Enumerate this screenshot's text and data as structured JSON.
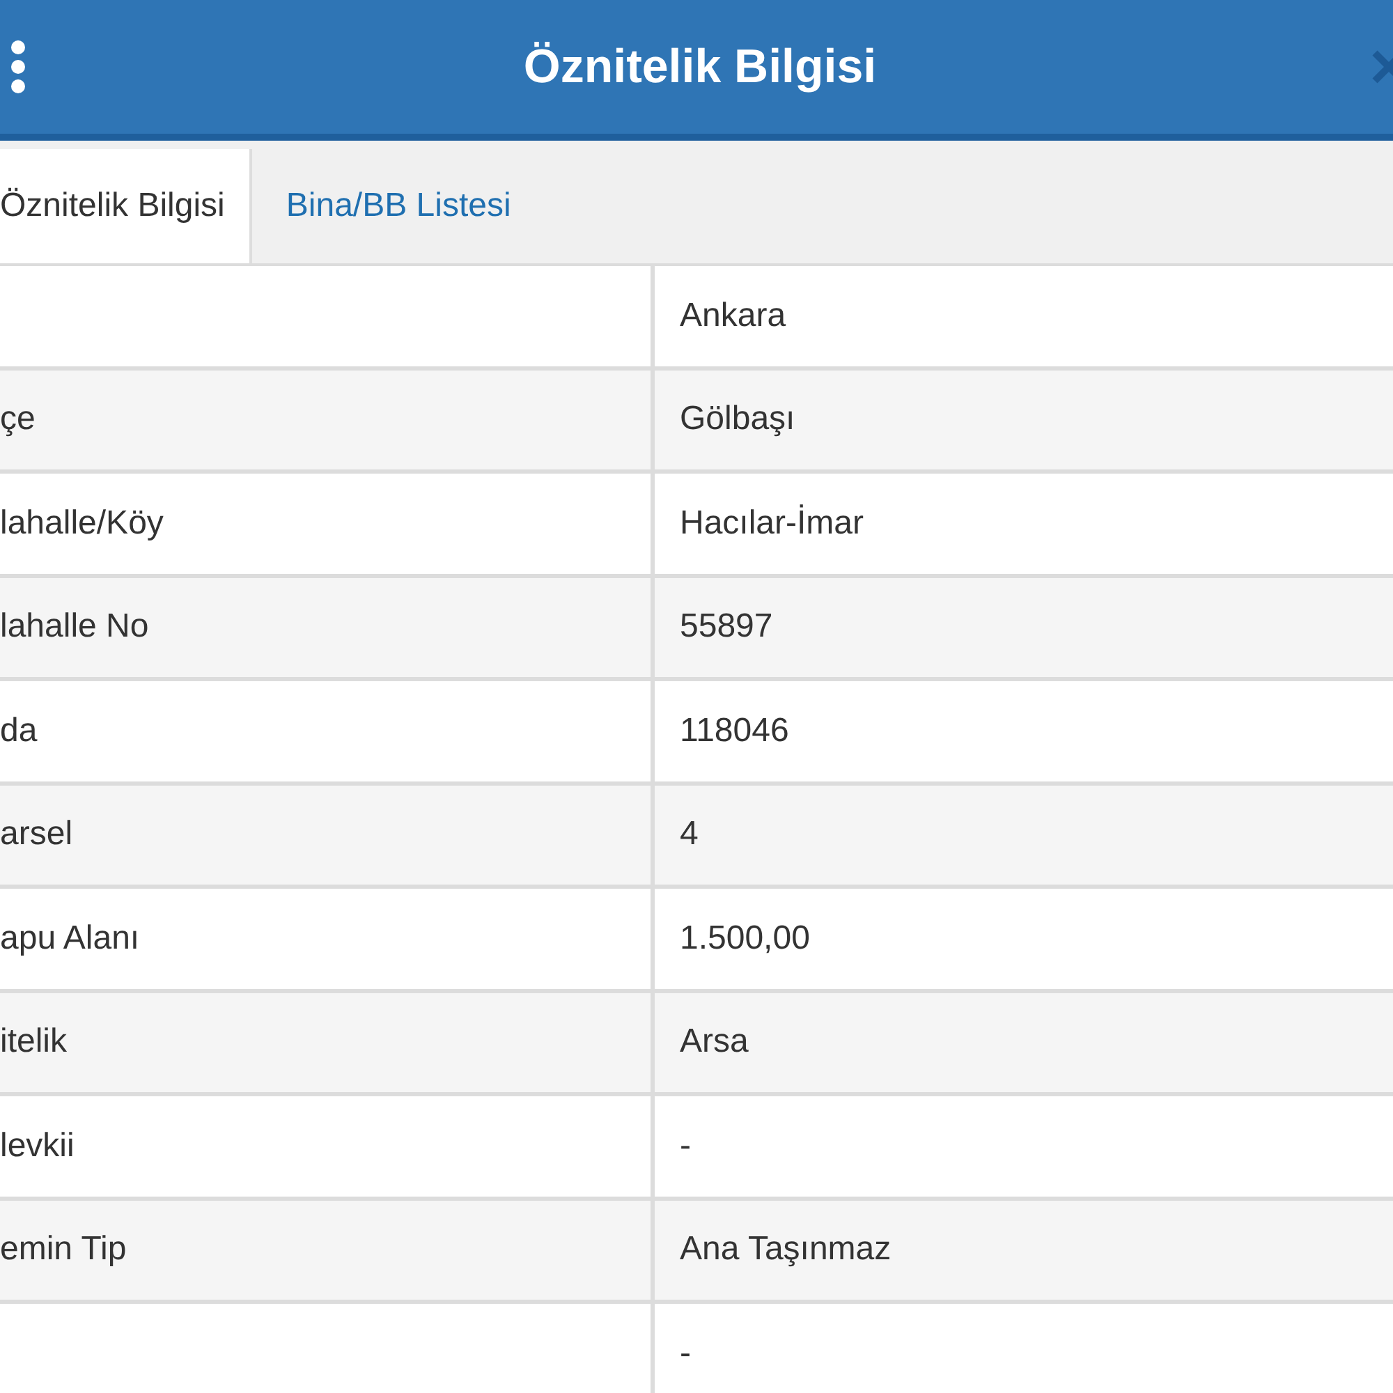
{
  "window": {
    "title": "Öznitelik Bilgisi"
  },
  "tabs": [
    {
      "label": "Öznitelik Bilgisi",
      "selected": true
    },
    {
      "label": "Bina/BB Listesi",
      "selected": false
    }
  ],
  "table": {
    "rows": [
      {
        "value": "Ankara"
      },
      {
        "label": "çe",
        "value": "Gölbaşı"
      },
      {
        "label": "lahalle/Köy",
        "value": "Hacılar-İmar"
      },
      {
        "label": "lahalle No",
        "value": "55897"
      },
      {
        "label": "da",
        "value": "118046"
      },
      {
        "label": "arsel",
        "value": "4"
      },
      {
        "label": "apu Alanı",
        "value": "1.500,00"
      },
      {
        "label": "itelik",
        "value": "Arsa"
      },
      {
        "label": "levkii",
        "value": "-"
      },
      {
        "label": "emin Tip",
        "value": "Ana Taşınmaz"
      },
      {
        "value": "-"
      }
    ]
  }
}
